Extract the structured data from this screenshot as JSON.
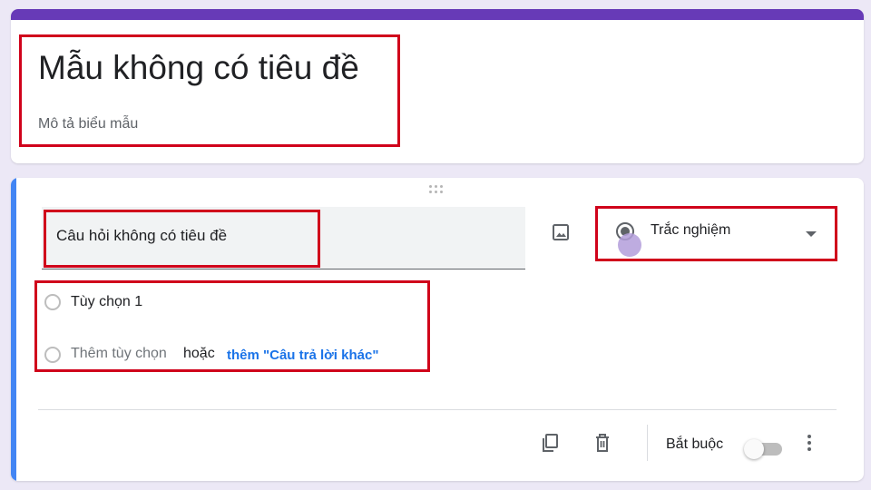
{
  "form": {
    "title": "Mẫu không có tiêu đề",
    "description": "Mô tả biểu mẫu",
    "accent_color": "#673ab7"
  },
  "question": {
    "title": "Câu hỏi không có tiêu đề",
    "type": "Trắc nghiệm",
    "option_label": "Tùy chọn 1",
    "add_option": "Thêm tùy chọn",
    "or": "hoặc",
    "add_other": "thêm \"Câu trả lời khác\"",
    "required_label": "Bắt buộc",
    "required": false,
    "active_color": "#4285f4"
  },
  "icons": {
    "image": "image-icon",
    "type": "radio-button-icon",
    "dropdown": "arrow-drop-down-icon",
    "duplicate": "copy-icon",
    "delete": "trash-icon",
    "more": "more-vertical-icon",
    "drag": "drag-handle-icon"
  },
  "highlight_color": "#d0021b"
}
